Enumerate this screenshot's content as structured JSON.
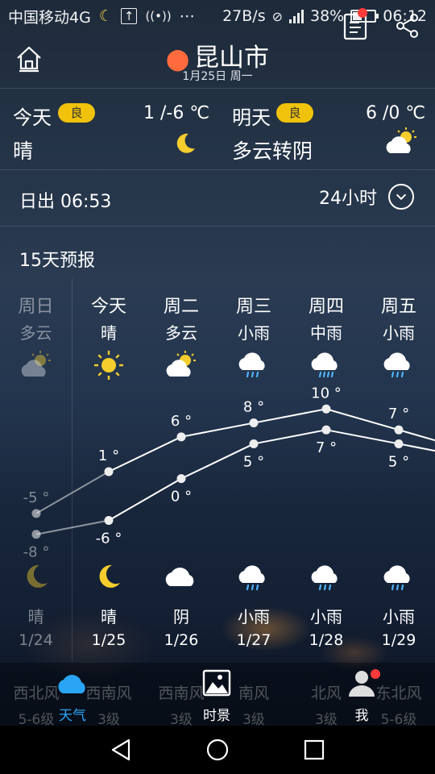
{
  "status_bar": {
    "carrier": "中国移动4G",
    "network_speed": "27B/s",
    "battery_percent": "38%",
    "battery_level": 0.38,
    "time": "06:12"
  },
  "header": {
    "city": "昆山市",
    "date": "1月25日 周一"
  },
  "today": {
    "label": "今天",
    "aqi": "良",
    "temp": "1 /-6 ℃",
    "condition": "晴",
    "icon": "moon-icon"
  },
  "tomorrow": {
    "label": "明天",
    "aqi": "良",
    "temp": "6 /0 ℃",
    "condition": "多云转阴",
    "icon": "partly-cloudy-icon"
  },
  "sunrise": "日出 06:53",
  "hourly_button": "24小时",
  "forecast_title": "15天预报",
  "colors": {
    "aqi": "#f0c20b",
    "active_tab": "#2aa4f4",
    "location_pin": "#ff6b3d",
    "badge": "#ff3b3b"
  },
  "days": [
    {
      "weekday": "周日",
      "day_cond": "多云",
      "day_icon": "partly-cloudy-icon",
      "high": "-5 °",
      "low": "-8 °",
      "night_icon": "moon-icon",
      "night_cond": "晴",
      "date": "1/24",
      "past": true
    },
    {
      "weekday": "今天",
      "day_cond": "晴",
      "day_icon": "sun-icon",
      "high": "1 °",
      "low": "-6 °",
      "night_icon": "moon-icon",
      "night_cond": "晴",
      "date": "1/25",
      "past": false
    },
    {
      "weekday": "周二",
      "day_cond": "多云",
      "day_icon": "partly-cloudy-icon",
      "high": "6 °",
      "low": "0 °",
      "night_icon": "cloud-icon",
      "night_cond": "阴",
      "date": "1/26",
      "past": false
    },
    {
      "weekday": "周三",
      "day_cond": "小雨",
      "day_icon": "light-rain-icon",
      "high": "8 °",
      "low": "5 °",
      "night_icon": "light-rain-icon",
      "night_cond": "小雨",
      "date": "1/27",
      "past": false
    },
    {
      "weekday": "周四",
      "day_cond": "中雨",
      "day_icon": "moderate-rain-icon",
      "high": "10 °",
      "low": "7 °",
      "night_icon": "light-rain-icon",
      "night_cond": "小雨",
      "date": "1/28",
      "past": false
    },
    {
      "weekday": "周五",
      "day_cond": "小雨",
      "day_icon": "light-rain-icon",
      "high": "7 °",
      "low": "5 °",
      "night_icon": "light-rain-icon",
      "night_cond": "小雨",
      "date": "1/29",
      "past": false
    }
  ],
  "chart_data": {
    "type": "line",
    "categories": [
      "1/24",
      "1/25",
      "1/26",
      "1/27",
      "1/28",
      "1/29"
    ],
    "series": [
      {
        "values": [
          -5,
          1,
          6,
          8,
          10,
          7
        ]
      },
      {
        "values": [
          -8,
          -6,
          0,
          5,
          7,
          5
        ]
      }
    ],
    "ylim": [
      -10,
      12
    ]
  },
  "wind": [
    {
      "dir": "西北风",
      "level": "5-6级"
    },
    {
      "dir": "西南风",
      "level": "3级"
    },
    {
      "dir": "西南风",
      "level": "3级"
    },
    {
      "dir": "南风",
      "level": "3级"
    },
    {
      "dir": "北风",
      "level": "3级"
    },
    {
      "dir": "东北风",
      "level": "5-6级"
    }
  ],
  "tabs": [
    {
      "label": "天气",
      "icon": "cloud-icon",
      "active": true
    },
    {
      "label": "时景",
      "icon": "photo-icon",
      "active": false
    },
    {
      "label": "我",
      "icon": "user-icon",
      "active": false
    }
  ]
}
